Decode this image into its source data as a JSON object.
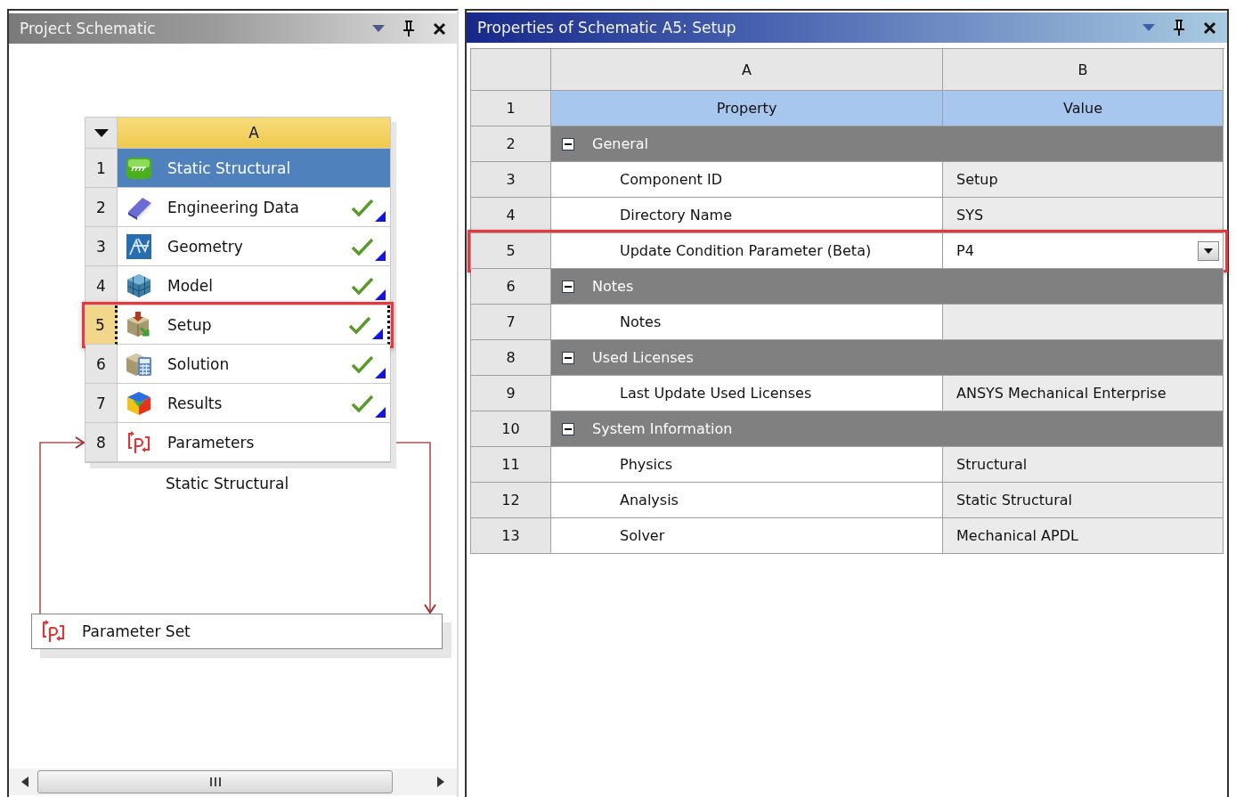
{
  "schematic": {
    "title": "Project Schematic",
    "system": {
      "column": "A",
      "rows": [
        {
          "number": "1",
          "label": "Static Structural",
          "kind": "system",
          "up_to_date": false,
          "selected": false,
          "highlighted": false
        },
        {
          "number": "2",
          "label": "Engineering Data",
          "kind": "component",
          "up_to_date": true,
          "selected": false,
          "highlighted": false
        },
        {
          "number": "3",
          "label": "Geometry",
          "kind": "component",
          "up_to_date": true,
          "selected": false,
          "highlighted": false
        },
        {
          "number": "4",
          "label": "Model",
          "kind": "component",
          "up_to_date": true,
          "selected": false,
          "highlighted": false
        },
        {
          "number": "5",
          "label": "Setup",
          "kind": "component",
          "up_to_date": true,
          "selected": true,
          "highlighted": true
        },
        {
          "number": "6",
          "label": "Solution",
          "kind": "component",
          "up_to_date": true,
          "selected": false,
          "highlighted": false
        },
        {
          "number": "7",
          "label": "Results",
          "kind": "component",
          "up_to_date": true,
          "selected": false,
          "highlighted": false
        },
        {
          "number": "8",
          "label": "Parameters",
          "kind": "parameters",
          "up_to_date": false,
          "selected": false,
          "highlighted": false
        }
      ],
      "caption": "Static Structural"
    },
    "parameter_set": {
      "label": "Parameter Set"
    }
  },
  "properties": {
    "title": "Properties of Schematic A5: Setup",
    "columns": [
      "A",
      "B"
    ],
    "rows": [
      {
        "number": "1",
        "kind": "header",
        "property": "Property",
        "value": "Value"
      },
      {
        "number": "2",
        "kind": "group",
        "property": "General",
        "expanded": true
      },
      {
        "number": "3",
        "kind": "property",
        "property": "Component ID",
        "value": "Setup"
      },
      {
        "number": "4",
        "kind": "property",
        "property": "Directory Name",
        "value": "SYS"
      },
      {
        "number": "5",
        "kind": "property",
        "property": "Update Condition Parameter (Beta)",
        "value": "P4",
        "dropdown": true,
        "highlighted": true
      },
      {
        "number": "6",
        "kind": "group",
        "property": "Notes",
        "expanded": true
      },
      {
        "number": "7",
        "kind": "property",
        "property": "Notes"
      },
      {
        "number": "8",
        "kind": "group",
        "property": "Used Licenses",
        "expanded": true
      },
      {
        "number": "9",
        "kind": "property",
        "property": "Last Update Used Licenses",
        "value": "ANSYS Mechanical Enterprise"
      },
      {
        "number": "10",
        "kind": "group",
        "property": "System Information",
        "expanded": true
      },
      {
        "number": "11",
        "kind": "property",
        "property": "Physics",
        "value": "Structural"
      },
      {
        "number": "12",
        "kind": "property",
        "property": "Analysis",
        "value": "Static Structural"
      },
      {
        "number": "13",
        "kind": "property",
        "property": "Solver",
        "value": "Mechanical APDL"
      }
    ]
  }
}
